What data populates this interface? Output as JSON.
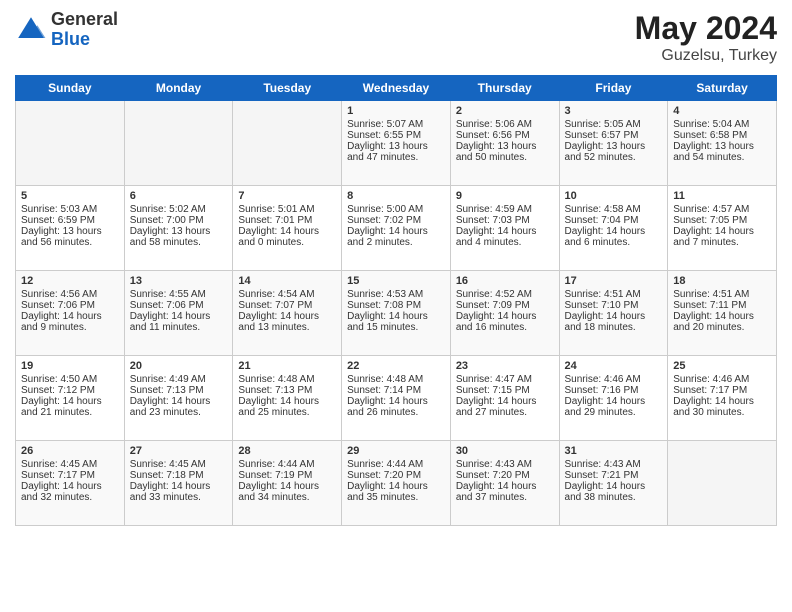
{
  "header": {
    "logo_general": "General",
    "logo_blue": "Blue",
    "title": "May 2024",
    "subtitle": "Guzelsu, Turkey"
  },
  "days_of_week": [
    "Sunday",
    "Monday",
    "Tuesday",
    "Wednesday",
    "Thursday",
    "Friday",
    "Saturday"
  ],
  "weeks": [
    [
      {
        "day": "",
        "sunrise": "",
        "sunset": "",
        "daylight": "",
        "empty": true
      },
      {
        "day": "",
        "sunrise": "",
        "sunset": "",
        "daylight": "",
        "empty": true
      },
      {
        "day": "",
        "sunrise": "",
        "sunset": "",
        "daylight": "",
        "empty": true
      },
      {
        "day": "1",
        "sunrise": "Sunrise: 5:07 AM",
        "sunset": "Sunset: 6:55 PM",
        "daylight": "Daylight: 13 hours and 47 minutes.",
        "empty": false
      },
      {
        "day": "2",
        "sunrise": "Sunrise: 5:06 AM",
        "sunset": "Sunset: 6:56 PM",
        "daylight": "Daylight: 13 hours and 50 minutes.",
        "empty": false
      },
      {
        "day": "3",
        "sunrise": "Sunrise: 5:05 AM",
        "sunset": "Sunset: 6:57 PM",
        "daylight": "Daylight: 13 hours and 52 minutes.",
        "empty": false
      },
      {
        "day": "4",
        "sunrise": "Sunrise: 5:04 AM",
        "sunset": "Sunset: 6:58 PM",
        "daylight": "Daylight: 13 hours and 54 minutes.",
        "empty": false
      }
    ],
    [
      {
        "day": "5",
        "sunrise": "Sunrise: 5:03 AM",
        "sunset": "Sunset: 6:59 PM",
        "daylight": "Daylight: 13 hours and 56 minutes.",
        "empty": false
      },
      {
        "day": "6",
        "sunrise": "Sunrise: 5:02 AM",
        "sunset": "Sunset: 7:00 PM",
        "daylight": "Daylight: 13 hours and 58 minutes.",
        "empty": false
      },
      {
        "day": "7",
        "sunrise": "Sunrise: 5:01 AM",
        "sunset": "Sunset: 7:01 PM",
        "daylight": "Daylight: 14 hours and 0 minutes.",
        "empty": false
      },
      {
        "day": "8",
        "sunrise": "Sunrise: 5:00 AM",
        "sunset": "Sunset: 7:02 PM",
        "daylight": "Daylight: 14 hours and 2 minutes.",
        "empty": false
      },
      {
        "day": "9",
        "sunrise": "Sunrise: 4:59 AM",
        "sunset": "Sunset: 7:03 PM",
        "daylight": "Daylight: 14 hours and 4 minutes.",
        "empty": false
      },
      {
        "day": "10",
        "sunrise": "Sunrise: 4:58 AM",
        "sunset": "Sunset: 7:04 PM",
        "daylight": "Daylight: 14 hours and 6 minutes.",
        "empty": false
      },
      {
        "day": "11",
        "sunrise": "Sunrise: 4:57 AM",
        "sunset": "Sunset: 7:05 PM",
        "daylight": "Daylight: 14 hours and 7 minutes.",
        "empty": false
      }
    ],
    [
      {
        "day": "12",
        "sunrise": "Sunrise: 4:56 AM",
        "sunset": "Sunset: 7:06 PM",
        "daylight": "Daylight: 14 hours and 9 minutes.",
        "empty": false
      },
      {
        "day": "13",
        "sunrise": "Sunrise: 4:55 AM",
        "sunset": "Sunset: 7:06 PM",
        "daylight": "Daylight: 14 hours and 11 minutes.",
        "empty": false
      },
      {
        "day": "14",
        "sunrise": "Sunrise: 4:54 AM",
        "sunset": "Sunset: 7:07 PM",
        "daylight": "Daylight: 14 hours and 13 minutes.",
        "empty": false
      },
      {
        "day": "15",
        "sunrise": "Sunrise: 4:53 AM",
        "sunset": "Sunset: 7:08 PM",
        "daylight": "Daylight: 14 hours and 15 minutes.",
        "empty": false
      },
      {
        "day": "16",
        "sunrise": "Sunrise: 4:52 AM",
        "sunset": "Sunset: 7:09 PM",
        "daylight": "Daylight: 14 hours and 16 minutes.",
        "empty": false
      },
      {
        "day": "17",
        "sunrise": "Sunrise: 4:51 AM",
        "sunset": "Sunset: 7:10 PM",
        "daylight": "Daylight: 14 hours and 18 minutes.",
        "empty": false
      },
      {
        "day": "18",
        "sunrise": "Sunrise: 4:51 AM",
        "sunset": "Sunset: 7:11 PM",
        "daylight": "Daylight: 14 hours and 20 minutes.",
        "empty": false
      }
    ],
    [
      {
        "day": "19",
        "sunrise": "Sunrise: 4:50 AM",
        "sunset": "Sunset: 7:12 PM",
        "daylight": "Daylight: 14 hours and 21 minutes.",
        "empty": false
      },
      {
        "day": "20",
        "sunrise": "Sunrise: 4:49 AM",
        "sunset": "Sunset: 7:13 PM",
        "daylight": "Daylight: 14 hours and 23 minutes.",
        "empty": false
      },
      {
        "day": "21",
        "sunrise": "Sunrise: 4:48 AM",
        "sunset": "Sunset: 7:13 PM",
        "daylight": "Daylight: 14 hours and 25 minutes.",
        "empty": false
      },
      {
        "day": "22",
        "sunrise": "Sunrise: 4:48 AM",
        "sunset": "Sunset: 7:14 PM",
        "daylight": "Daylight: 14 hours and 26 minutes.",
        "empty": false
      },
      {
        "day": "23",
        "sunrise": "Sunrise: 4:47 AM",
        "sunset": "Sunset: 7:15 PM",
        "daylight": "Daylight: 14 hours and 27 minutes.",
        "empty": false
      },
      {
        "day": "24",
        "sunrise": "Sunrise: 4:46 AM",
        "sunset": "Sunset: 7:16 PM",
        "daylight": "Daylight: 14 hours and 29 minutes.",
        "empty": false
      },
      {
        "day": "25",
        "sunrise": "Sunrise: 4:46 AM",
        "sunset": "Sunset: 7:17 PM",
        "daylight": "Daylight: 14 hours and 30 minutes.",
        "empty": false
      }
    ],
    [
      {
        "day": "26",
        "sunrise": "Sunrise: 4:45 AM",
        "sunset": "Sunset: 7:17 PM",
        "daylight": "Daylight: 14 hours and 32 minutes.",
        "empty": false
      },
      {
        "day": "27",
        "sunrise": "Sunrise: 4:45 AM",
        "sunset": "Sunset: 7:18 PM",
        "daylight": "Daylight: 14 hours and 33 minutes.",
        "empty": false
      },
      {
        "day": "28",
        "sunrise": "Sunrise: 4:44 AM",
        "sunset": "Sunset: 7:19 PM",
        "daylight": "Daylight: 14 hours and 34 minutes.",
        "empty": false
      },
      {
        "day": "29",
        "sunrise": "Sunrise: 4:44 AM",
        "sunset": "Sunset: 7:20 PM",
        "daylight": "Daylight: 14 hours and 35 minutes.",
        "empty": false
      },
      {
        "day": "30",
        "sunrise": "Sunrise: 4:43 AM",
        "sunset": "Sunset: 7:20 PM",
        "daylight": "Daylight: 14 hours and 37 minutes.",
        "empty": false
      },
      {
        "day": "31",
        "sunrise": "Sunrise: 4:43 AM",
        "sunset": "Sunset: 7:21 PM",
        "daylight": "Daylight: 14 hours and 38 minutes.",
        "empty": false
      },
      {
        "day": "",
        "sunrise": "",
        "sunset": "",
        "daylight": "",
        "empty": true
      }
    ]
  ]
}
